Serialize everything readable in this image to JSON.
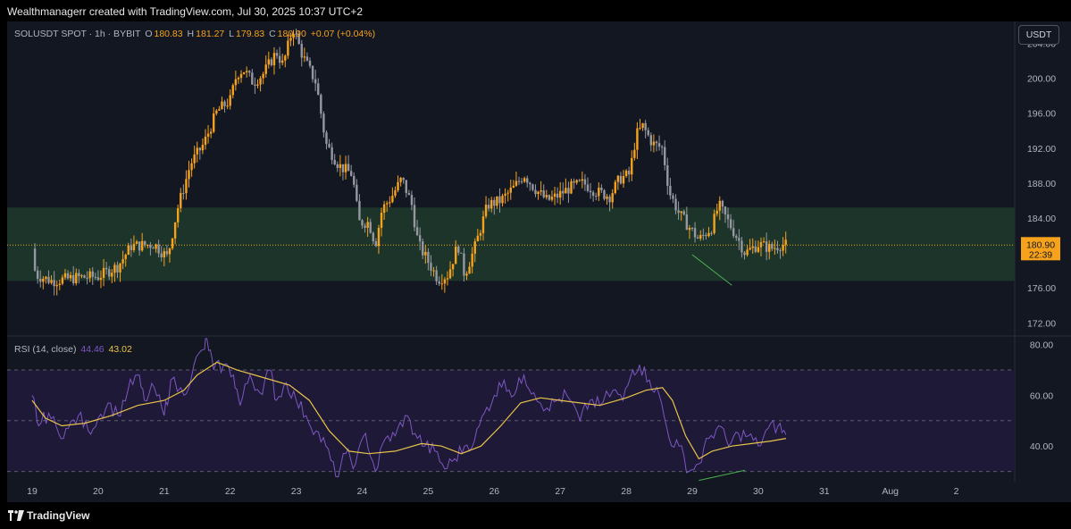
{
  "header": {
    "credit": "Wealthmanagerr created with TradingView.com, Jul 30, 2025 10:37 UTC+2"
  },
  "symbol": {
    "name": "SOLUSDT SPOT · 1h · BYBIT",
    "o_label": "O",
    "o": "180.83",
    "h_label": "H",
    "h": "181.27",
    "l_label": "L",
    "l": "179.83",
    "c_label": "C",
    "c": "180.90",
    "change": "+0.07 (+0.04%)"
  },
  "currency_button": "USDT",
  "rsi_legend": {
    "name": "RSI (14, close)",
    "value": "44.46",
    "ma_value": "43.02"
  },
  "price_tag": {
    "price": "180.90",
    "countdown": "22:39"
  },
  "footer": {
    "brand": "TradingView"
  },
  "colors": {
    "background": "#131722",
    "bull": "#f7a21b",
    "bear": "#9598a1",
    "zone": "#1e3a2a",
    "rsi_line": "#7e57c2",
    "rsi_ma": "#e9c349",
    "rsi_band": "#1f1a3a",
    "divergence": "#4caf50"
  },
  "chart_data": [
    {
      "type": "candlestick",
      "title": "SOLUSDT SPOT · 1h · BYBIT",
      "x_labels": [
        "19",
        "20",
        "21",
        "22",
        "23",
        "24",
        "25",
        "26",
        "27",
        "28",
        "29",
        "30",
        "31",
        "Aug",
        "2"
      ],
      "y_ticks": [
        172,
        176,
        180,
        184,
        188,
        192,
        196,
        200,
        204
      ],
      "ylim": [
        170.5,
        206.5
      ],
      "support_zone": [
        176.8,
        185.2
      ],
      "last_price": 180.9,
      "price_path": [
        [
          19.0,
          180.5
        ],
        [
          19.05,
          177.5
        ],
        [
          19.3,
          176.8
        ],
        [
          19.7,
          177.2
        ],
        [
          20.0,
          177.3
        ],
        [
          20.3,
          178.5
        ],
        [
          20.5,
          180.8
        ],
        [
          20.85,
          181.0
        ],
        [
          21.05,
          179.5
        ],
        [
          21.2,
          185.0
        ],
        [
          21.4,
          190.2
        ],
        [
          21.6,
          192.5
        ],
        [
          21.8,
          196.2
        ],
        [
          22.0,
          197.5
        ],
        [
          22.1,
          200.5
        ],
        [
          22.2,
          201.0
        ],
        [
          22.35,
          199.5
        ],
        [
          22.5,
          200.5
        ],
        [
          22.7,
          203.0
        ],
        [
          22.8,
          201.5
        ],
        [
          22.95,
          205.8
        ],
        [
          23.1,
          202.5
        ],
        [
          23.3,
          199.5
        ],
        [
          23.45,
          192.5
        ],
        [
          23.65,
          190.0
        ],
        [
          23.85,
          189.0
        ],
        [
          23.95,
          183.5
        ],
        [
          24.1,
          183.5
        ],
        [
          24.2,
          181.0
        ],
        [
          24.3,
          185.0
        ],
        [
          24.45,
          186.5
        ],
        [
          24.6,
          188.5
        ],
        [
          24.75,
          185.5
        ],
        [
          24.85,
          181.0
        ],
        [
          25.0,
          179.0
        ],
        [
          25.15,
          177.0
        ],
        [
          25.3,
          177.5
        ],
        [
          25.45,
          181.0
        ],
        [
          25.55,
          177.5
        ],
        [
          25.7,
          180.5
        ],
        [
          25.9,
          185.5
        ],
        [
          26.1,
          186.0
        ],
        [
          26.3,
          187.5
        ],
        [
          26.45,
          189.0
        ],
        [
          26.6,
          187.5
        ],
        [
          26.8,
          186.0
        ],
        [
          26.95,
          186.5
        ],
        [
          27.15,
          187.5
        ],
        [
          27.35,
          188.0
        ],
        [
          27.55,
          187.0
        ],
        [
          27.75,
          186.5
        ],
        [
          27.9,
          188.5
        ],
        [
          28.05,
          189.0
        ],
        [
          28.15,
          193.5
        ],
        [
          28.25,
          194.5
        ],
        [
          28.4,
          192.5
        ],
        [
          28.55,
          192.0
        ],
        [
          28.65,
          187.0
        ],
        [
          28.8,
          184.5
        ],
        [
          28.95,
          183.0
        ],
        [
          29.1,
          181.5
        ],
        [
          29.3,
          183.0
        ],
        [
          29.4,
          185.5
        ],
        [
          29.55,
          183.5
        ],
        [
          29.7,
          181.5
        ],
        [
          29.8,
          180.0
        ],
        [
          30.0,
          181.0
        ],
        [
          30.2,
          180.5
        ],
        [
          30.35,
          181.0
        ],
        [
          30.42,
          180.9
        ]
      ],
      "divergence_line": {
        "from": [
          29.0,
          179.8
        ],
        "to": [
          29.6,
          176.3
        ]
      }
    },
    {
      "type": "line",
      "title": "RSI (14, close)",
      "y_ticks": [
        40,
        60,
        80
      ],
      "ylim": [
        26,
        83
      ],
      "bands": {
        "upper": 70,
        "middle": 50,
        "lower": 30
      },
      "series": [
        {
          "name": "RSI",
          "points": [
            [
              19.0,
              60
            ],
            [
              19.1,
              48
            ],
            [
              19.25,
              53
            ],
            [
              19.4,
              45
            ],
            [
              19.55,
              47
            ],
            [
              19.7,
              52
            ],
            [
              19.85,
              46
            ],
            [
              20.0,
              51
            ],
            [
              20.15,
              57
            ],
            [
              20.3,
              52
            ],
            [
              20.45,
              62
            ],
            [
              20.6,
              68
            ],
            [
              20.7,
              58
            ],
            [
              20.85,
              63
            ],
            [
              21.0,
              52
            ],
            [
              21.1,
              66
            ],
            [
              21.3,
              60
            ],
            [
              21.45,
              72
            ],
            [
              21.6,
              78
            ],
            [
              21.65,
              82
            ],
            [
              21.75,
              70
            ],
            [
              21.9,
              72
            ],
            [
              22.05,
              68
            ],
            [
              22.15,
              56
            ],
            [
              22.3,
              68
            ],
            [
              22.45,
              61
            ],
            [
              22.6,
              70
            ],
            [
              22.7,
              58
            ],
            [
              22.85,
              65
            ],
            [
              23.0,
              58
            ],
            [
              23.15,
              52
            ],
            [
              23.3,
              46
            ],
            [
              23.45,
              40
            ],
            [
              23.6,
              28
            ],
            [
              23.75,
              37
            ],
            [
              23.9,
              33
            ],
            [
              24.05,
              45
            ],
            [
              24.2,
              30
            ],
            [
              24.35,
              43
            ],
            [
              24.5,
              44
            ],
            [
              24.65,
              52
            ],
            [
              24.8,
              45
            ],
            [
              24.95,
              40
            ],
            [
              25.1,
              38
            ],
            [
              25.25,
              31
            ],
            [
              25.4,
              35
            ],
            [
              25.55,
              40
            ],
            [
              25.7,
              42
            ],
            [
              25.85,
              53
            ],
            [
              26.0,
              60
            ],
            [
              26.15,
              66
            ],
            [
              26.3,
              60
            ],
            [
              26.45,
              68
            ],
            [
              26.6,
              61
            ],
            [
              26.8,
              55
            ],
            [
              26.95,
              58
            ],
            [
              27.1,
              60
            ],
            [
              27.3,
              50
            ],
            [
              27.45,
              58
            ],
            [
              27.6,
              56
            ],
            [
              27.8,
              62
            ],
            [
              27.95,
              58
            ],
            [
              28.1,
              70
            ],
            [
              28.2,
              72
            ],
            [
              28.35,
              66
            ],
            [
              28.5,
              60
            ],
            [
              28.65,
              43
            ],
            [
              28.8,
              40
            ],
            [
              28.95,
              30
            ],
            [
              29.1,
              33
            ],
            [
              29.25,
              43
            ],
            [
              29.4,
              48
            ],
            [
              29.55,
              40
            ],
            [
              29.7,
              45
            ],
            [
              29.85,
              44
            ],
            [
              30.0,
              40
            ],
            [
              30.15,
              47
            ],
            [
              30.3,
              48
            ],
            [
              30.42,
              44.46
            ]
          ]
        },
        {
          "name": "RSI-based MA",
          "points": [
            [
              19.0,
              58
            ],
            [
              19.2,
              51
            ],
            [
              19.45,
              48
            ],
            [
              19.8,
              49
            ],
            [
              20.2,
              52
            ],
            [
              20.6,
              56
            ],
            [
              21.0,
              58
            ],
            [
              21.3,
              62
            ],
            [
              21.5,
              68
            ],
            [
              21.8,
              73
            ],
            [
              22.1,
              70
            ],
            [
              22.5,
              67
            ],
            [
              22.9,
              64
            ],
            [
              23.2,
              58
            ],
            [
              23.5,
              46
            ],
            [
              23.8,
              38
            ],
            [
              24.1,
              37
            ],
            [
              24.5,
              38
            ],
            [
              24.9,
              41
            ],
            [
              25.2,
              40
            ],
            [
              25.5,
              37
            ],
            [
              25.8,
              40
            ],
            [
              26.1,
              48
            ],
            [
              26.4,
              57
            ],
            [
              26.7,
              59
            ],
            [
              27.0,
              58
            ],
            [
              27.3,
              57
            ],
            [
              27.6,
              56
            ],
            [
              28.0,
              59
            ],
            [
              28.3,
              62
            ],
            [
              28.55,
              63
            ],
            [
              28.7,
              58
            ],
            [
              28.9,
              44
            ],
            [
              29.1,
              35
            ],
            [
              29.3,
              38
            ],
            [
              29.6,
              40
            ],
            [
              29.9,
              41
            ],
            [
              30.2,
              42
            ],
            [
              30.42,
              43.02
            ]
          ]
        }
      ],
      "divergence_line": {
        "from": [
          29.1,
          26.5
        ],
        "to": [
          29.8,
          30.5
        ]
      }
    }
  ]
}
